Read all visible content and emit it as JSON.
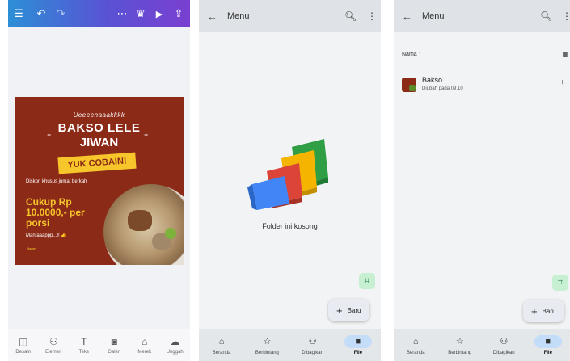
{
  "canva": {
    "design": {
      "shout": "Ueeeenaaakkkk",
      "headline1": "BAKSO LELE",
      "headline2": "JIWAN",
      "cta": "YUK COBAIN!",
      "subtitle": "Diskon khusus jumat berkah",
      "price": "Cukup Rp 10.0000,- per porsi",
      "tagline": "Mantaaappp...!! 👍",
      "footer": "Jiwan"
    },
    "tools": [
      {
        "label": "Desain",
        "icon": "layout-icon"
      },
      {
        "label": "Elemen",
        "icon": "shapes-icon"
      },
      {
        "label": "Teks",
        "icon": "text-icon"
      },
      {
        "label": "Galeri",
        "icon": "camera-icon"
      },
      {
        "label": "Merek",
        "icon": "brand-icon"
      },
      {
        "label": "Unggah",
        "icon": "upload-icon"
      }
    ]
  },
  "drive_empty": {
    "title": "Menu",
    "empty_message": "Folder ini kosong",
    "new_label": "Baru"
  },
  "drive_list": {
    "title": "Menu",
    "sort_label": "Nama ↑",
    "file": {
      "name": "Bakso",
      "modified": "Diubah pada 09.10"
    },
    "new_label": "Baru"
  },
  "nav": [
    {
      "label": "Beranda",
      "icon": "home-icon"
    },
    {
      "label": "Berbintang",
      "icon": "star-icon"
    },
    {
      "label": "Dibagikan",
      "icon": "shared-icon"
    },
    {
      "label": "File",
      "icon": "folder-icon"
    }
  ],
  "colors": {
    "accent_gradient_start": "#2c8fd6",
    "accent_gradient_end": "#7a3fd0",
    "design_bg": "#8c2a18",
    "design_yellow": "#f6c62b",
    "nav_active": "#c3dcf7"
  }
}
